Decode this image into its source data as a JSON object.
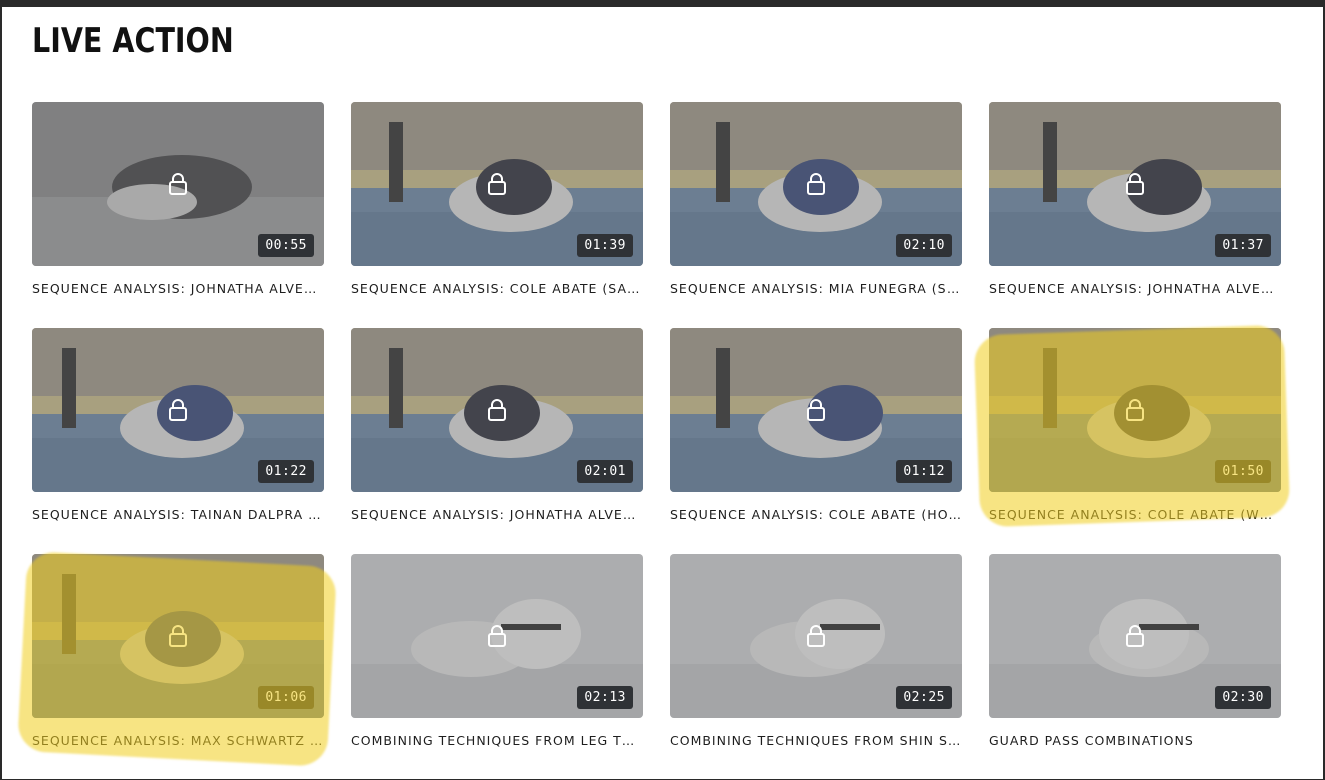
{
  "section": {
    "title": "LIVE ACTION"
  },
  "videos": [
    {
      "title": "SEQUENCE ANALYSIS: JOHNATHA ALVES ...",
      "duration": "00:55",
      "scene": "gray"
    },
    {
      "title": "SEQUENCE ANALYSIS: COLE ABATE (SAN ...",
      "duration": "01:39",
      "scene": "arena-blue"
    },
    {
      "title": "SEQUENCE ANALYSIS: MIA FUNEGRA (SA...",
      "duration": "02:10",
      "scene": "arena-blue"
    },
    {
      "title": "SEQUENCE ANALYSIS: JOHNATHA ALVES ...",
      "duration": "01:37",
      "scene": "arena-blue"
    },
    {
      "title": "SEQUENCE ANALYSIS: TAINAN DALPRA (H...",
      "duration": "01:22",
      "scene": "arena-blue"
    },
    {
      "title": "SEQUENCE ANALYSIS: JOHNATHA ALVES ...",
      "duration": "02:01",
      "scene": "arena-blue"
    },
    {
      "title": "SEQUENCE ANALYSIS: COLE ABATE (HOU...",
      "duration": "01:12",
      "scene": "arena-blue"
    },
    {
      "title": "SEQUENCE ANALYSIS: COLE ABATE (WOR...",
      "duration": "01:50",
      "scene": "arena-blue"
    },
    {
      "title": "SEQUENCE ANALYSIS: MAX SCHWARTZ (2...",
      "duration": "01:06",
      "scene": "arena-blue"
    },
    {
      "title": "COMBINING TECHNIQUES FROM LEG TRAP",
      "duration": "02:13",
      "scene": "studio"
    },
    {
      "title": "COMBINING TECHNIQUES FROM SHIN SLI...",
      "duration": "02:25",
      "scene": "studio"
    },
    {
      "title": "GUARD PASS COMBINATIONS",
      "duration": "02:30",
      "scene": "studio"
    }
  ],
  "icons": {
    "thumbnail_overlay": "lock-icon"
  },
  "colors": {
    "highlight": "#f0cd1e",
    "duration_badge": "#2f3236"
  }
}
